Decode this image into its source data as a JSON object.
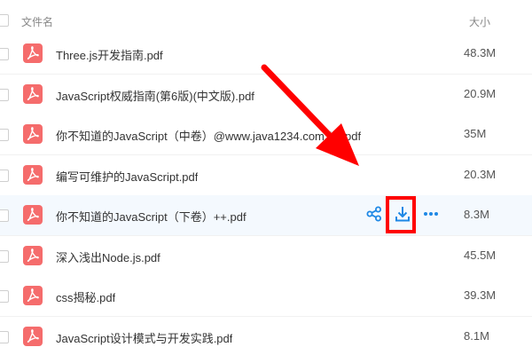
{
  "header": {
    "name_label": "文件名",
    "size_label": "大小"
  },
  "files": [
    {
      "name": "Three.js开发指南.pdf",
      "size": "48.3M"
    },
    {
      "name": "JavaScript权威指南(第6版)(中文版).pdf",
      "size": "20.9M"
    },
    {
      "name": "你不知道的JavaScript（中卷）@www.java1234.com (1).pdf",
      "size": "35M"
    },
    {
      "name": "编写可维护的JavaScript.pdf",
      "size": "20.3M"
    },
    {
      "name": "你不知道的JavaScript（下卷）++.pdf",
      "size": "8.3M"
    },
    {
      "name": "深入浅出Node.js.pdf",
      "size": "45.5M"
    },
    {
      "name": "css揭秘.pdf",
      "size": "39.3M"
    },
    {
      "name": "JavaScript设计模式与开发实践.pdf",
      "size": "8.1M"
    }
  ],
  "hovered_row_index": 4,
  "row_actions": [
    {
      "icon": "share-icon"
    },
    {
      "icon": "download-icon"
    },
    {
      "icon": "more-icon"
    }
  ],
  "colors": {
    "pdf_icon": "#f56c6c",
    "action_icon": "#1e88e5",
    "annotation": "#ff0000",
    "hover_bg": "#f4f9fe"
  }
}
